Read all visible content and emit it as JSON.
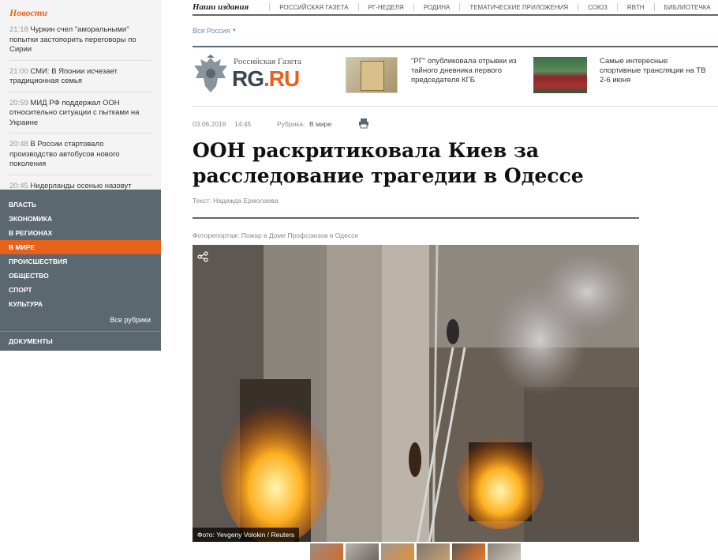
{
  "sidebar": {
    "news_title": "Новости",
    "news": [
      {
        "time": "21:18",
        "text": "Чуркин счел \"аморальными\" попытки застопорить переговоры по Сирии"
      },
      {
        "time": "21:00",
        "text": "СМИ: В Японии исчезает традиционная семья"
      },
      {
        "time": "20:59",
        "text": "МИД РФ поддержал ООН относительно ситуации с пытками на Украине"
      },
      {
        "time": "20:48",
        "text": "В России стартовало производство автобусов нового поколения"
      },
      {
        "time": "20:45",
        "text": "Нидерланды осенью назовут"
      }
    ],
    "menu": [
      {
        "label": "Власть"
      },
      {
        "label": "Экономика"
      },
      {
        "label": "В регионах"
      },
      {
        "label": "В мире"
      },
      {
        "label": "Происшествия"
      },
      {
        "label": "Общество"
      },
      {
        "label": "Спорт"
      },
      {
        "label": "Культура"
      }
    ],
    "all_rubrics": "Все рубрики",
    "documents": "Документы",
    "active_color": "#e8611a"
  },
  "topnav": {
    "head": "Наши издания",
    "items": [
      "Российская газета",
      "РГ-Неделя",
      "Родина",
      "Тематические приложения",
      "Союз",
      "RBTH",
      "Библиотечка"
    ]
  },
  "region": "Вся Россия",
  "brand": {
    "small": "Российская Газета",
    "rg": "RG",
    "dot": ".",
    "ru": "RU"
  },
  "promos": [
    {
      "text": "\"РГ\" опубликовала отрывки из тайного дневника первого председателя КГБ"
    },
    {
      "text": "Самые интересные спортивные трансляции на ТВ 2-6 июня"
    }
  ],
  "article": {
    "date": "03.06.2016",
    "time": "14:45",
    "rubric_label": "Рубрика:",
    "rubric": "В мире",
    "headline": "ООН раскритиковала Киев за расследование трагедии в Одессе",
    "author": "Текст: Надежда Ермолаева",
    "photo_caption": "Фоторепортаж: Пожар в Доме Профсоюзов в Одессе",
    "photo_credit": "Фото: Yevgeny Volokin / Reuters"
  }
}
